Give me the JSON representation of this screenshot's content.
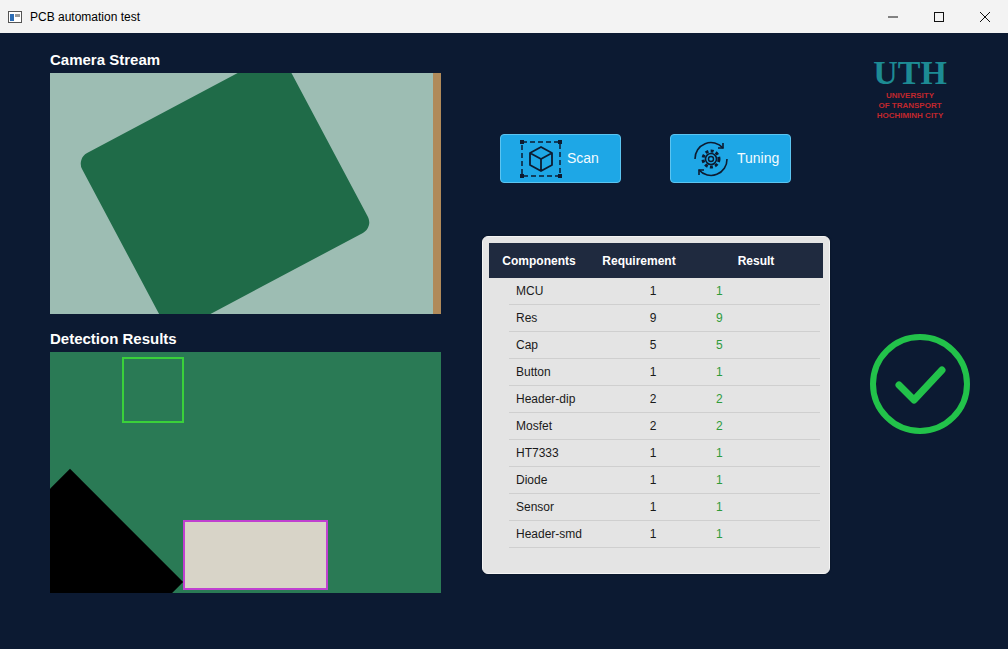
{
  "window": {
    "title": "PCB automation test"
  },
  "camera": {
    "label": "Camera Stream"
  },
  "detection": {
    "label": "Detection Results"
  },
  "logo": {
    "mark": "UTH",
    "lines": [
      "UNIVERSITY",
      "OF TRANSPORT",
      "HOCHIMINH CITY"
    ]
  },
  "buttons": [
    {
      "label": "Scan",
      "kind": "scan"
    },
    {
      "label": "Tuning",
      "kind": "tuning"
    }
  ],
  "table": {
    "columns": [
      "Components",
      "Requirement",
      "Result"
    ],
    "rows": [
      {
        "cells": [
          "MCU",
          "1",
          "1"
        ],
        "ok": true
      },
      {
        "cells": [
          "Res",
          "9",
          "9"
        ],
        "ok": true
      },
      {
        "cells": [
          "Cap",
          "5",
          "5"
        ],
        "ok": true
      },
      {
        "cells": [
          "Button",
          "1",
          "1"
        ],
        "ok": true
      },
      {
        "cells": [
          "Header-dip",
          "2",
          "2"
        ],
        "ok": true
      },
      {
        "cells": [
          "Mosfet",
          "2",
          "2"
        ],
        "ok": true
      },
      {
        "cells": [
          "HT7333",
          "1",
          "1"
        ],
        "ok": true
      },
      {
        "cells": [
          "Diode",
          "1",
          "1"
        ],
        "ok": true
      },
      {
        "cells": [
          "Sensor",
          "1",
          "1"
        ],
        "ok": true
      },
      {
        "cells": [
          "Header-smd",
          "1",
          "1"
        ],
        "ok": true
      }
    ]
  },
  "status": {
    "passed": true
  }
}
